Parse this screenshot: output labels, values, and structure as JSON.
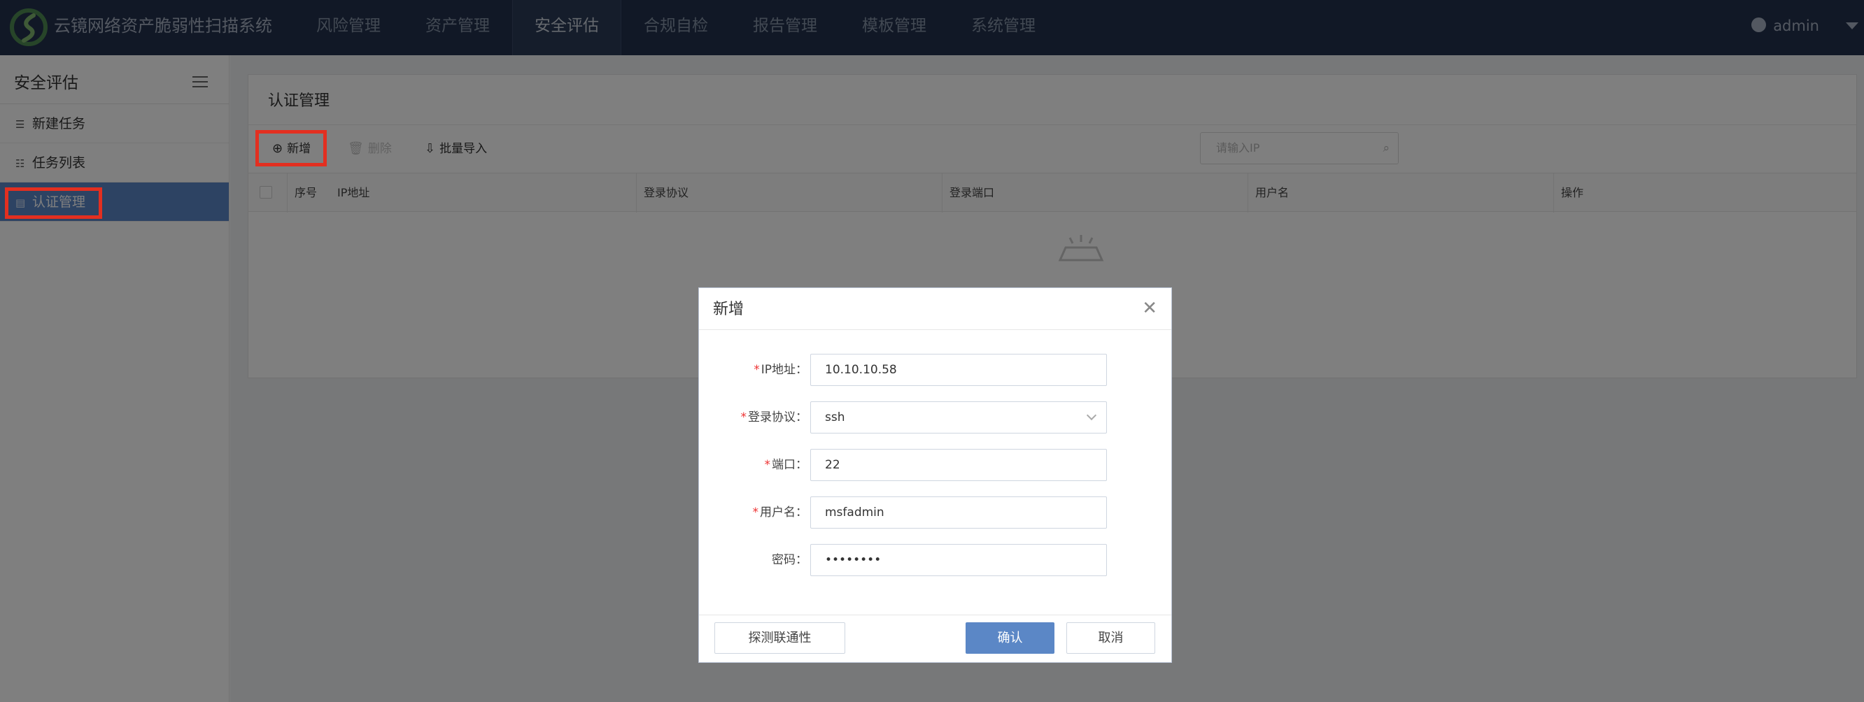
{
  "app": {
    "title": "云镜网络资产脆弱性扫描系统",
    "user": "admin"
  },
  "nav": {
    "items": [
      {
        "label": "风险管理"
      },
      {
        "label": "资产管理"
      },
      {
        "label": "安全评估"
      },
      {
        "label": "合规自检"
      },
      {
        "label": "报告管理"
      },
      {
        "label": "模板管理"
      },
      {
        "label": "系统管理"
      }
    ],
    "active": "安全评估"
  },
  "sidebar": {
    "title": "安全评估",
    "items": [
      {
        "label": "新建任务",
        "icon": "new-task-icon"
      },
      {
        "label": "任务列表",
        "icon": "list-icon"
      },
      {
        "label": "认证管理",
        "icon": "auth-icon"
      }
    ],
    "active": "认证管理"
  },
  "panel": {
    "title": "认证管理",
    "toolbar": {
      "add_label": "新增",
      "delete_label": "删除",
      "import_label": "批量导入"
    },
    "search": {
      "placeholder": "请输入IP"
    },
    "table": {
      "columns": [
        "序号",
        "IP地址",
        "登录协议",
        "登录端口",
        "用户名",
        "操作"
      ],
      "rows": []
    }
  },
  "modal": {
    "title": "新增",
    "fields": [
      {
        "label": "IP地址：",
        "required": true,
        "value": "10.10.10.58"
      },
      {
        "label": "登录协议：",
        "required": true,
        "value": "ssh",
        "type": "select"
      },
      {
        "label": "端口：",
        "required": true,
        "value": "22"
      },
      {
        "label": "用户名：",
        "required": true,
        "value": "msfadmin"
      },
      {
        "label": "密码：",
        "required": false,
        "value": "••••••••"
      }
    ],
    "buttons": {
      "probe": "探测联通性",
      "ok": "确认",
      "cancel": "取消"
    }
  },
  "colors": {
    "topbar": "#22314c",
    "accent": "#5b87c6",
    "highlight": "#e32f20"
  }
}
